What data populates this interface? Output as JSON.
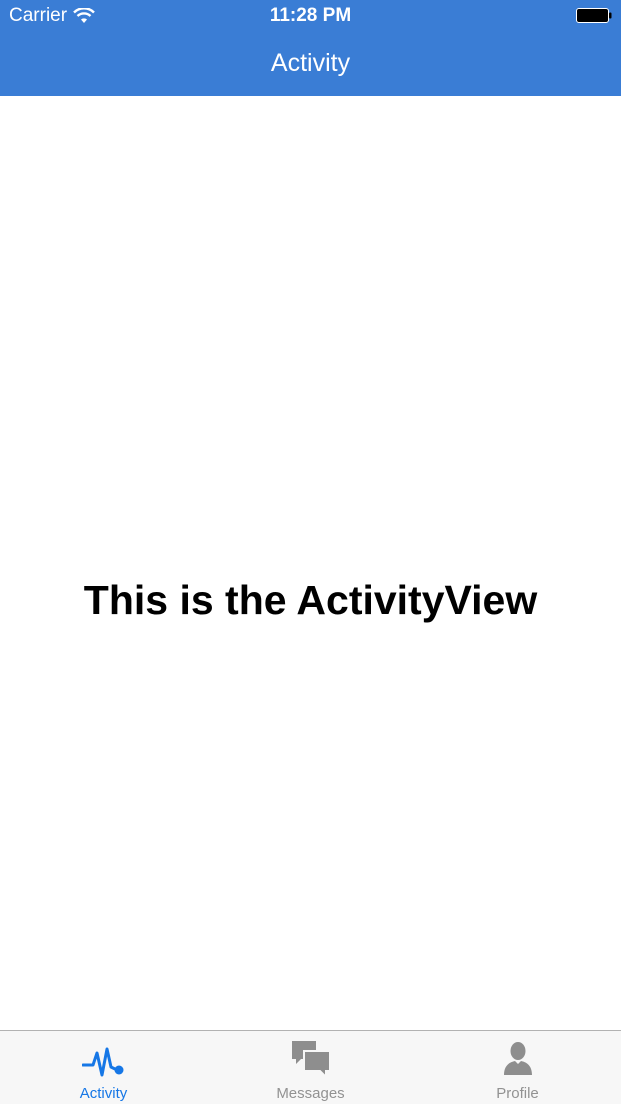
{
  "status_bar": {
    "carrier": "Carrier",
    "wifi_icon": "wifi-icon",
    "time": "11:28 PM",
    "battery_icon": "battery-icon"
  },
  "nav": {
    "title": "Activity",
    "background_color": "#3a7dd5"
  },
  "main": {
    "text": "This is the ActivityView"
  },
  "tab_bar": {
    "tabs": [
      {
        "label": "Activity",
        "icon": "activity-pulse-icon",
        "active": true
      },
      {
        "label": "Messages",
        "icon": "messages-icon",
        "active": false
      },
      {
        "label": "Profile",
        "icon": "profile-icon",
        "active": false
      }
    ],
    "active_color": "#1677e6",
    "inactive_color": "#929292"
  }
}
